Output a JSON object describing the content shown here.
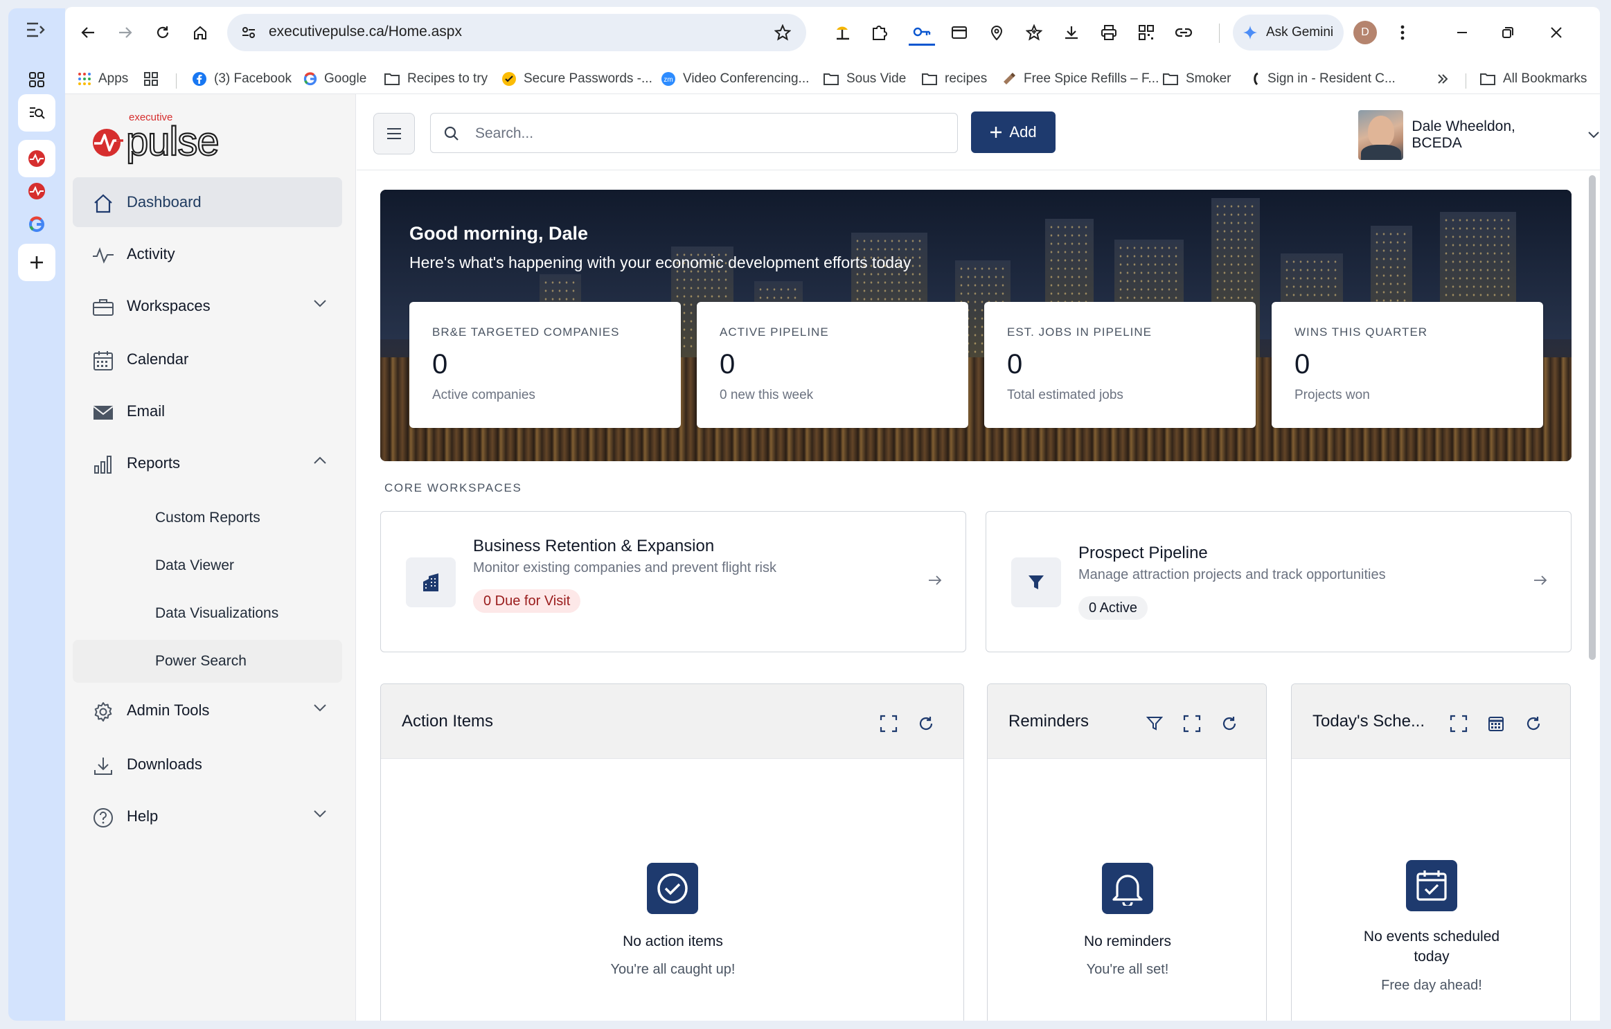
{
  "browser": {
    "url": "executivepulse.ca/Home.aspx",
    "gemini_label": "Ask Gemini",
    "profile_initial": "D",
    "bookmarks": [
      {
        "label": "Apps",
        "icon": "apps-grid-icon"
      },
      {
        "label": "",
        "icon": "grid-icon"
      },
      {
        "label": "(3) Facebook",
        "icon": "facebook-icon"
      },
      {
        "label": "Google",
        "icon": "google-icon"
      },
      {
        "label": "Recipes to try",
        "icon": "folder-icon"
      },
      {
        "label": "Secure Passwords -...",
        "icon": "check-badge-icon"
      },
      {
        "label": "Video Conferencing...",
        "icon": "zoom-icon"
      },
      {
        "label": "Sous Vide",
        "icon": "folder-icon"
      },
      {
        "label": "recipes",
        "icon": "folder-icon"
      },
      {
        "label": "Free Spice Refills – F...",
        "icon": "spice-icon"
      },
      {
        "label": "Smoker",
        "icon": "folder-icon"
      },
      {
        "label": "Sign in - Resident C...",
        "icon": "site-icon"
      },
      {
        "label": "All Bookmarks",
        "icon": "folder-icon"
      }
    ]
  },
  "sidebar": {
    "logo_small": "executive",
    "logo_big": "pulse",
    "items": [
      {
        "label": "Dashboard",
        "icon": "home-icon",
        "active": true
      },
      {
        "label": "Activity",
        "icon": "activity-icon"
      },
      {
        "label": "Workspaces",
        "icon": "briefcase-icon",
        "expandable": true
      },
      {
        "label": "Calendar",
        "icon": "calendar-icon"
      },
      {
        "label": "Email",
        "icon": "envelope-icon"
      },
      {
        "label": "Reports",
        "icon": "bar-chart-icon",
        "expanded": true
      },
      {
        "label": "Admin Tools",
        "icon": "gear-icon",
        "expandable": true
      },
      {
        "label": "Downloads",
        "icon": "download-icon"
      },
      {
        "label": "Help",
        "icon": "help-icon",
        "expandable": true
      }
    ],
    "report_subitems": [
      "Custom Reports",
      "Data Viewer",
      "Data Visualizations",
      "Power Search"
    ]
  },
  "topbar": {
    "search_placeholder": "Search...",
    "add_label": "Add",
    "user_name": "Dale Wheeldon, BCEDA"
  },
  "hero": {
    "greeting": "Good morning, Dale",
    "subtitle": "Here's what's happening with your economic development efforts today",
    "stats": [
      {
        "title": "BR&E TARGETED COMPANIES",
        "value": "0",
        "sub": "Active companies"
      },
      {
        "title": "ACTIVE PIPELINE",
        "value": "0",
        "sub": "0 new this week"
      },
      {
        "title": "EST. JOBS IN PIPELINE",
        "value": "0",
        "sub": "Total estimated jobs"
      },
      {
        "title": "WINS THIS QUARTER",
        "value": "0",
        "sub": "Projects won"
      }
    ]
  },
  "workspaces": {
    "section_title": "CORE WORKSPACES",
    "cards": [
      {
        "title": "Business Retention & Expansion",
        "desc": "Monitor existing companies and prevent flight risk",
        "badge": "0 Due for Visit",
        "badge_color": "#fde8e8"
      },
      {
        "title": "Prospect Pipeline",
        "desc": "Manage attraction projects and track opportunities",
        "badge": "0 Active",
        "badge_color": "#f1f2f4"
      }
    ]
  },
  "panels": [
    {
      "title": "Action Items",
      "empty_title": "No action items",
      "empty_sub": "You're all caught up!"
    },
    {
      "title": "Reminders",
      "empty_title": "No reminders",
      "empty_sub": "You're all set!"
    },
    {
      "title": "Today's Sche...",
      "empty_title": "No events scheduled today",
      "empty_sub": "Free day ahead!"
    }
  ],
  "colors": {
    "brand_navy": "#1e3a6e",
    "logo_red": "#d62e2e"
  }
}
